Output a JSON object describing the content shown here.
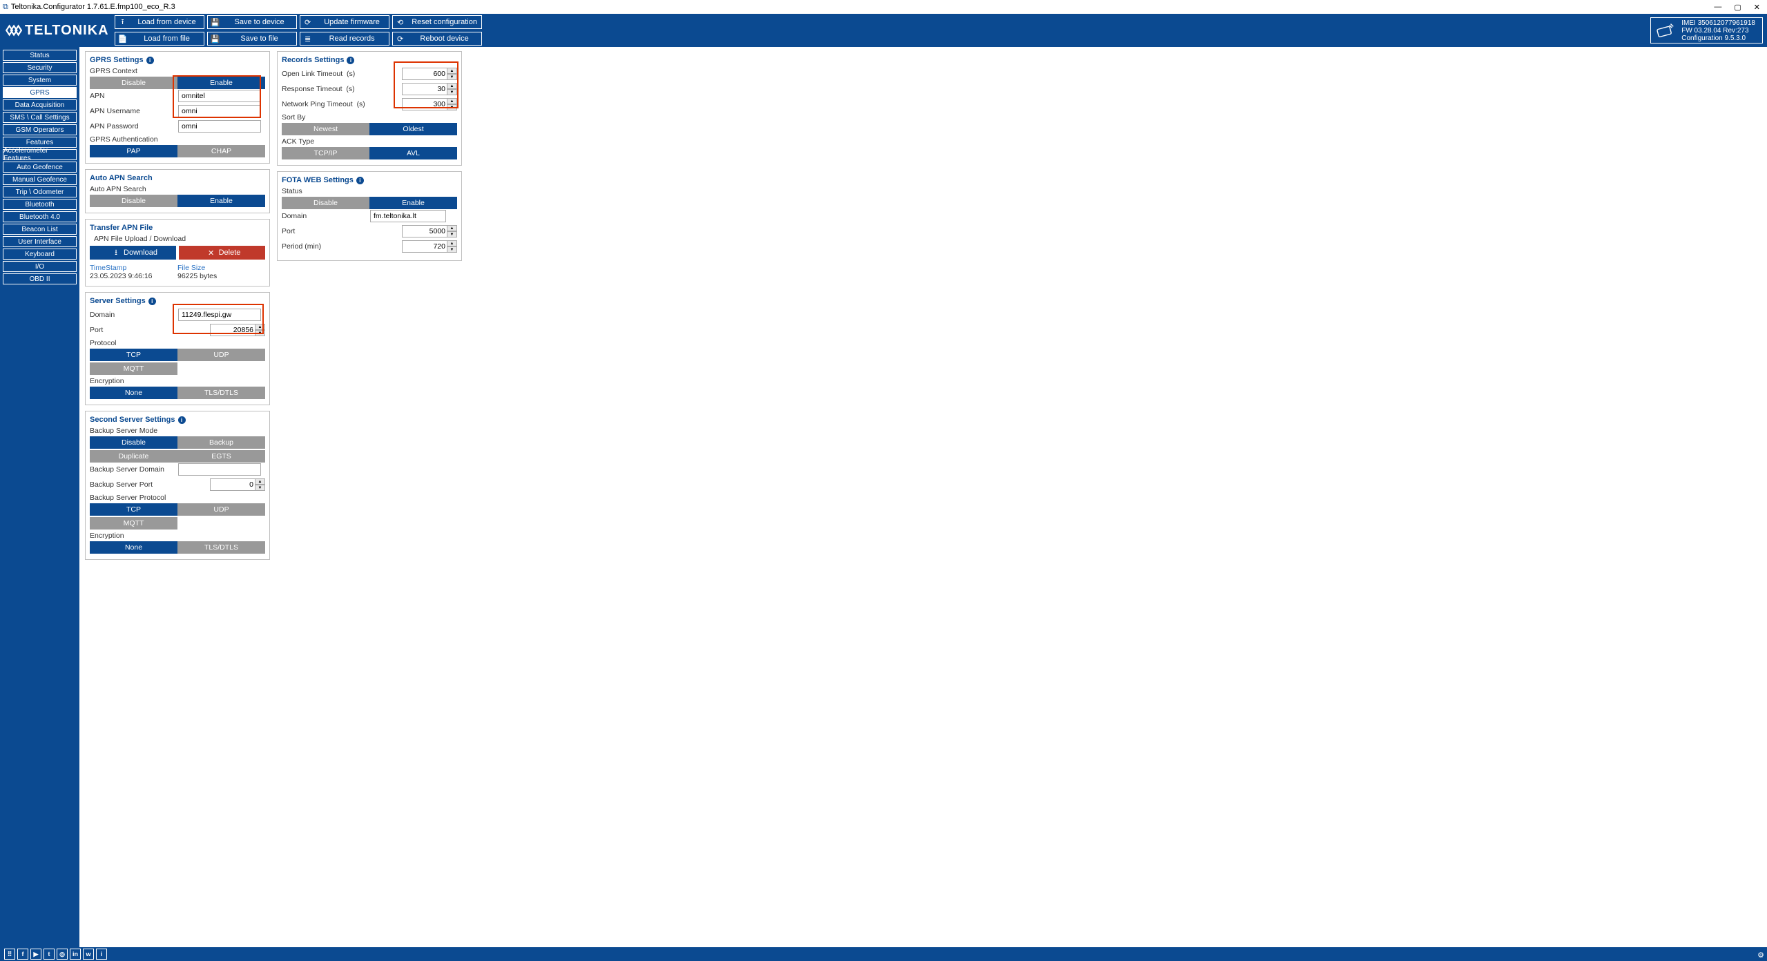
{
  "window": {
    "title": "Teltonika.Configurator 1.7.61.E.fmp100_eco_R.3"
  },
  "brand": "TELTONIKA",
  "toolbar": {
    "r1": [
      "Load from device",
      "Save to device",
      "Update firmware",
      "Reset configuration"
    ],
    "r2": [
      "Load from file",
      "Save to file",
      "Read records",
      "Reboot device"
    ]
  },
  "device": {
    "imei": "IMEI 350612077961918",
    "fw": "FW 03.28.04 Rev:273",
    "cfg": "Configuration 9.5.3.0"
  },
  "nav": [
    "Status",
    "Security",
    "System",
    "GPRS",
    "Data Acquisition",
    "SMS \\ Call Settings",
    "GSM Operators",
    "Features",
    "Accelerometer Features",
    "Auto Geofence",
    "Manual Geofence",
    "Trip \\ Odometer",
    "Bluetooth",
    "Bluetooth 4.0",
    "Beacon List",
    "User Interface",
    "Keyboard",
    "I/O",
    "OBD II"
  ],
  "nav_active": 3,
  "gprs": {
    "title": "GPRS Settings",
    "context": "GPRS Context",
    "disable": "Disable",
    "enable": "Enable",
    "apn_l": "APN",
    "apn_v": "omnitel",
    "user_l": "APN Username",
    "user_v": "omni",
    "pass_l": "APN Password",
    "pass_v": "omni",
    "auth_l": "GPRS Authentication",
    "pap": "PAP",
    "chap": "CHAP"
  },
  "autoapn": {
    "title": "Auto APN Search",
    "lab": "Auto APN Search",
    "disable": "Disable",
    "enable": "Enable"
  },
  "transfer": {
    "title": "Transfer APN File",
    "upl": "APN File Upload / Download",
    "dl": "Download",
    "del": "Delete",
    "ts_h": "TimeStamp",
    "ts_v": "23.05.2023 9:46:16",
    "fs_h": "File Size",
    "fs_v": "96225 bytes"
  },
  "server": {
    "title": "Server Settings",
    "dom_l": "Domain",
    "dom_v": "11249.flespi.gw",
    "port_l": "Port",
    "port_v": "20856",
    "proto_l": "Protocol",
    "tcp": "TCP",
    "udp": "UDP",
    "mqtt": "MQTT",
    "enc_l": "Encryption",
    "none": "None",
    "tls": "TLS/DTLS"
  },
  "second": {
    "title": "Second Server Settings",
    "mode_l": "Backup Server Mode",
    "disable": "Disable",
    "backup": "Backup",
    "dup": "Duplicate",
    "egts": "EGTS",
    "dom_l": "Backup Server Domain",
    "dom_v": "",
    "port_l": "Backup Server Port",
    "port_v": "0",
    "proto_l": "Backup Server Protocol",
    "tcp": "TCP",
    "udp": "UDP",
    "mqtt": "MQTT",
    "enc_l": "Encryption",
    "none": "None",
    "tls": "TLS/DTLS"
  },
  "records": {
    "title": "Records Settings",
    "olt_l": "Open Link Timeout",
    "olt_v": "600",
    "rt_l": "Response Timeout",
    "rt_v": "30",
    "npt_l": "Network Ping Timeout",
    "npt_v": "300",
    "unit": "(s)",
    "sort_l": "Sort By",
    "newest": "Newest",
    "oldest": "Oldest",
    "ack_l": "ACK Type",
    "tcpip": "TCP/IP",
    "avl": "AVL"
  },
  "fota": {
    "title": "FOTA WEB Settings",
    "stat_l": "Status",
    "disable": "Disable",
    "enable": "Enable",
    "dom_l": "Domain",
    "dom_v": "fm.teltonika.lt",
    "port_l": "Port",
    "port_v": "5000",
    "per_l": "Period (min)",
    "per_v": "720"
  }
}
